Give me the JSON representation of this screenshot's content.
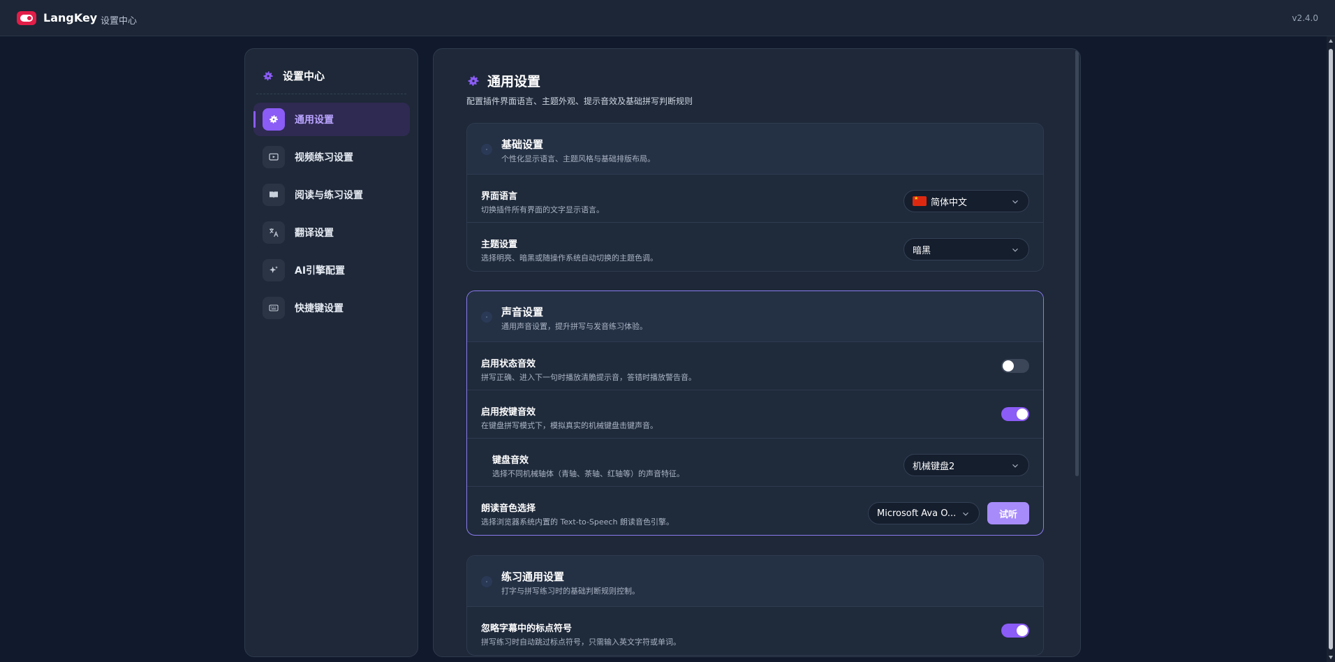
{
  "app": {
    "name": "LangKey",
    "subtitle": "设置中心",
    "version": "v2.4.0"
  },
  "sidebar": {
    "title": "设置中心",
    "items": [
      {
        "label": "通用设置",
        "icon": "gear-icon",
        "active": true
      },
      {
        "label": "视频练习设置",
        "icon": "play-screen-icon"
      },
      {
        "label": "阅读与练习设置",
        "icon": "book-icon"
      },
      {
        "label": "翻译设置",
        "icon": "translate-icon"
      },
      {
        "label": "AI引擎配置",
        "icon": "sparkle-icon"
      },
      {
        "label": "快捷键设置",
        "icon": "keyboard-icon"
      }
    ]
  },
  "page": {
    "title": "通用设置",
    "subtitle": "配置插件界面语言、主题外观、提示音效及基础拼写判断规则"
  },
  "sections": {
    "basic": {
      "title": "基础设置",
      "desc": "个性化显示语言、主题风格与基础排版布局。",
      "rows": {
        "language": {
          "title": "界面语言",
          "desc": "切换插件所有界面的文字显示语言。",
          "value": "简体中文"
        },
        "theme": {
          "title": "主题设置",
          "desc": "选择明亮、暗黑或随操作系统自动切换的主题色调。",
          "value": "暗黑"
        }
      }
    },
    "sound": {
      "title": "声音设置",
      "desc": "通用声音设置，提升拼写与发音练习体验。",
      "rows": {
        "status_sound": {
          "title": "启用状态音效",
          "desc": "拼写正确、进入下一句时播放清脆提示音，答错时播放警告音。",
          "enabled": false
        },
        "key_sound": {
          "title": "启用按键音效",
          "desc": "在键盘拼写模式下，模拟真实的机械键盘击键声音。",
          "enabled": true
        },
        "keyboard_sound": {
          "title": "键盘音效",
          "desc": "选择不同机械轴体（青轴、茶轴、红轴等）的声音特征。",
          "value": "机械键盘2"
        },
        "voice": {
          "title": "朗读音色选择",
          "desc": "选择浏览器系统内置的 Text-to-Speech 朗读音色引擎。",
          "value": "Microsoft Ava O...",
          "listen_label": "试听"
        }
      }
    },
    "practice": {
      "title": "练习通用设置",
      "desc": "打字与拼写练习时的基础判断规则控制。",
      "rows": {
        "ignore_punct": {
          "title": "忽略字幕中的标点符号",
          "desc": "拼写练习时自动跳过标点符号，只需输入英文字符或单词。",
          "enabled": true
        }
      }
    }
  },
  "colors": {
    "accent": "#8b5cf6",
    "brand": "#e11d48",
    "background": "#111a2c"
  }
}
